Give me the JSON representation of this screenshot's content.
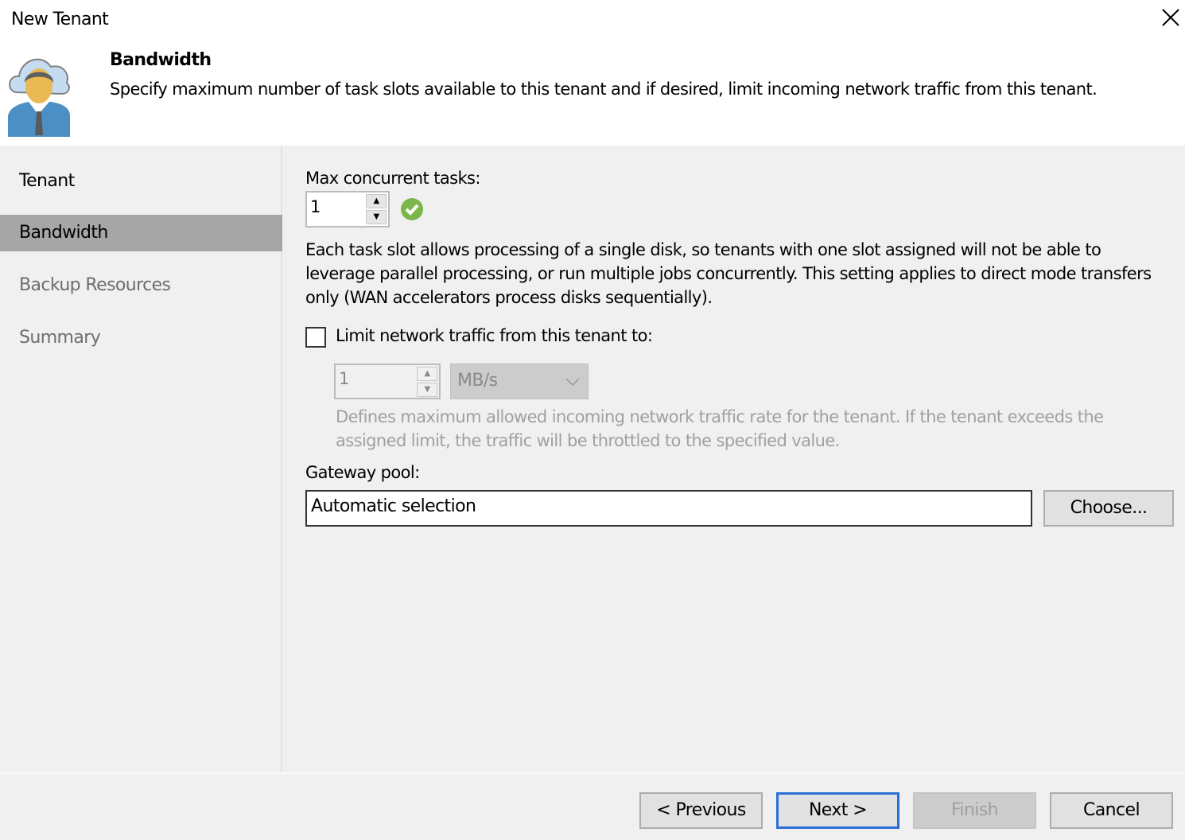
{
  "window": {
    "title": "New Tenant"
  },
  "header": {
    "title": "Bandwidth",
    "description": "Specify maximum number of task slots available to this tenant and if desired, limit incoming network traffic from this tenant."
  },
  "sidebar": {
    "items": [
      {
        "label": "Tenant",
        "state": "done"
      },
      {
        "label": "Bandwidth",
        "state": "active"
      },
      {
        "label": "Backup Resources",
        "state": "pending"
      },
      {
        "label": "Summary",
        "state": "pending"
      }
    ]
  },
  "main": {
    "max_tasks": {
      "label": "Max concurrent tasks:",
      "value": "1",
      "status_icon": "check-circle-icon",
      "status_color": "#7ab648"
    },
    "tasks_info": "Each task slot allows processing of a single disk, so tenants with one slot assigned will not be able to leverage parallel processing, or run multiple jobs concurrently. This setting applies to direct mode transfers only (WAN accelerators process disks sequentially).",
    "limit": {
      "label": "Limit network traffic from this tenant to:",
      "checked": false,
      "value": "1",
      "unit": "MB/s",
      "info": "Defines maximum allowed incoming network traffic rate for the tenant.  If the tenant exceeds the assigned limit, the traffic will be throttled to the specified value."
    },
    "gateway": {
      "label": "Gateway pool:",
      "value": "Automatic selection",
      "choose_label": "Choose..."
    }
  },
  "footer": {
    "previous": "< Previous",
    "next": "Next >",
    "finish": "Finish",
    "cancel": "Cancel"
  },
  "colors": {
    "accent": "#2b6fd6",
    "selected": "#a6a6a6"
  }
}
